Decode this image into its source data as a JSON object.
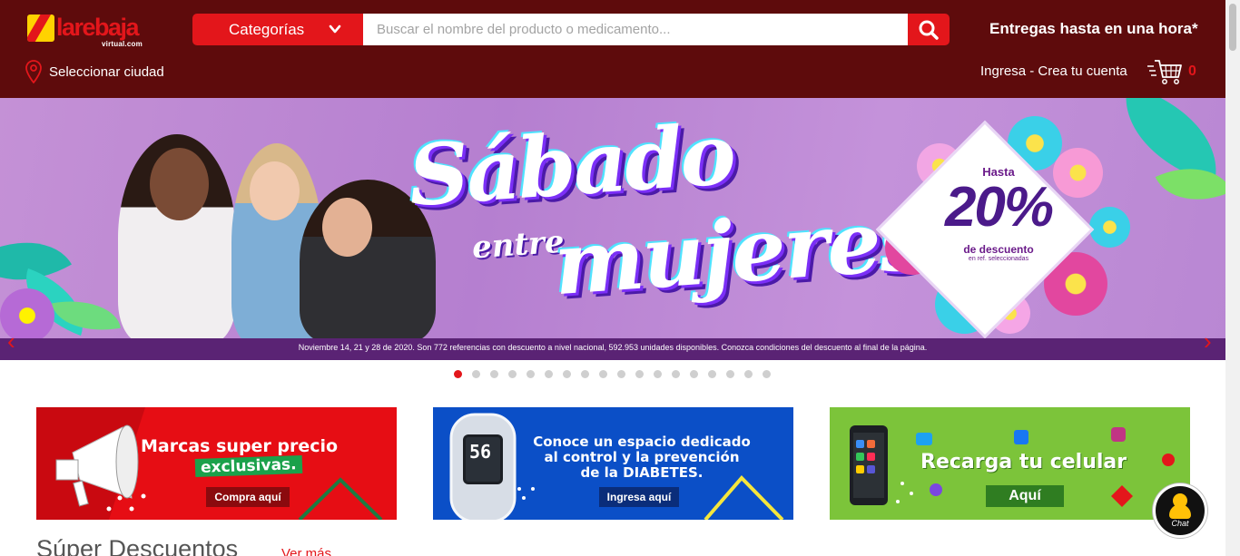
{
  "header": {
    "logo_text": "larebaja",
    "logo_sub": "virtual.com",
    "categories_label": "Categorías",
    "search_placeholder": "Buscar el nombre del producto o medicamento...",
    "delivery_text": "Entregas hasta en una hora*",
    "city_label": "Seleccionar ciudad",
    "login_label": "Ingresa - Crea tu cuenta",
    "cart_count": "0"
  },
  "banner": {
    "title_line1": "Sábado",
    "title_line2": "entre",
    "title_line3": "mujeres",
    "discount_prefix": "Hasta",
    "discount_value": "20%",
    "discount_text": "de descuento",
    "discount_sub": "en ref. seleccionadas",
    "note": "Noviembre 14, 21 y 28 de 2020. Son 772 referencias con descuento a nivel nacional, 592.953 unidades disponibles. Conozca condiciones del descuento al final de la página.",
    "slide_count": 18,
    "active_slide": 1
  },
  "promos": [
    {
      "title_line1": "Marcas super precio",
      "title_line2": "exclusivas.",
      "button": "Compra aquí"
    },
    {
      "title_line1": "Conoce un espacio dedicado",
      "title_line2": "al control y la prevención",
      "title_line3": "de la DIABETES.",
      "button": "Ingresa aquí",
      "meter_value": "56"
    },
    {
      "title_line1": "Recarga tu celular",
      "button": "Aquí"
    }
  ],
  "section": {
    "title": "Súper Descuentos",
    "link": "Ver más"
  },
  "chat": {
    "label": "Chat"
  },
  "colors": {
    "header_bg": "#5e0b0c",
    "brand_red": "#e3161b",
    "logo_yellow": "#ffd200"
  }
}
